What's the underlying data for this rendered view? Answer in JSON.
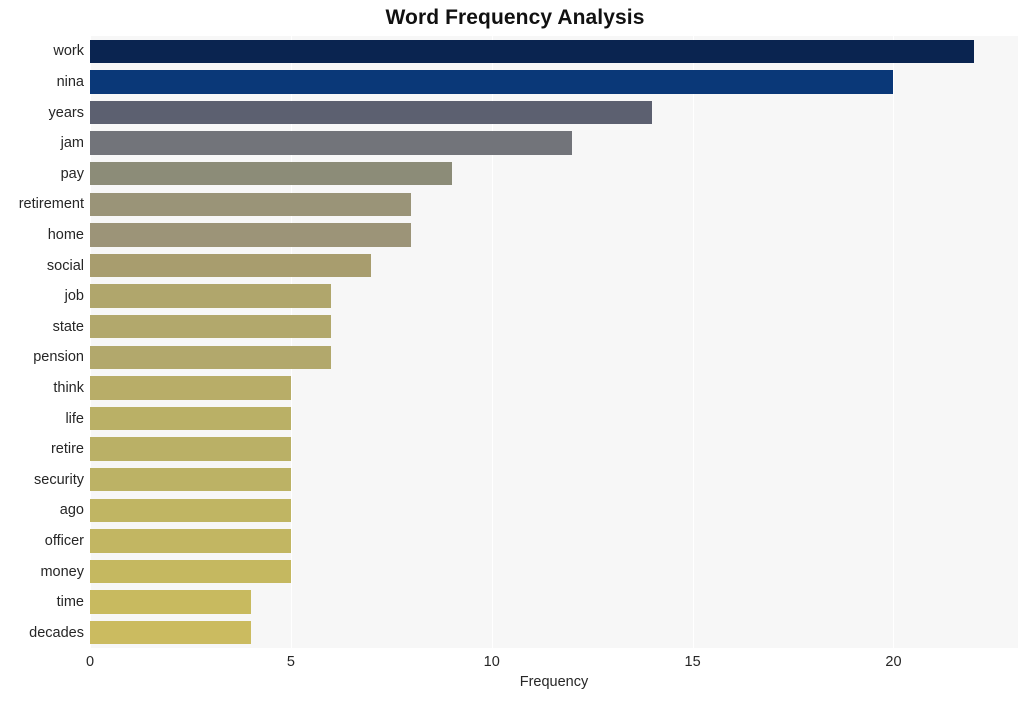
{
  "chart_data": {
    "type": "bar",
    "orientation": "horizontal",
    "title": "Word Frequency Analysis",
    "xlabel": "Frequency",
    "ylabel": "",
    "categories": [
      "work",
      "nina",
      "years",
      "jam",
      "pay",
      "retirement",
      "home",
      "social",
      "job",
      "state",
      "pension",
      "think",
      "life",
      "retire",
      "security",
      "ago",
      "officer",
      "money",
      "time",
      "decades"
    ],
    "values": [
      22,
      20,
      14,
      12,
      9,
      8,
      8,
      7,
      6,
      6,
      6,
      5,
      5,
      5,
      5,
      5,
      5,
      5,
      4,
      4
    ],
    "bar_colors": [
      "#0a2450",
      "#0a3878",
      "#5c6070",
      "#72747a",
      "#8c8c78",
      "#9a9478",
      "#9c9478",
      "#a89d6e",
      "#b0a66c",
      "#b2a86c",
      "#b2a86c",
      "#b8ad68",
      "#bab066",
      "#bab066",
      "#bcb265",
      "#c0b563",
      "#c2b662",
      "#c5b860",
      "#c8ba5f",
      "#cbbb60"
    ],
    "xlim": [
      0,
      23.1
    ],
    "xticks": [
      0,
      5,
      10,
      15,
      20
    ],
    "xticklabels": [
      "0",
      "5",
      "10",
      "15",
      "20"
    ],
    "yticklabels": [
      "work",
      "nina",
      "years",
      "jam",
      "pay",
      "retirement",
      "home",
      "social",
      "job",
      "state",
      "pension",
      "think",
      "life",
      "retire",
      "security",
      "ago",
      "officer",
      "money",
      "time",
      "decades"
    ],
    "grid": true,
    "grid_axis": "x",
    "legend": false,
    "plot_background": "#f7f7f7",
    "figure_background": "#ffffff",
    "grid_color": "#ffffff",
    "title_color": "#111111",
    "tick_label_color": "#262626"
  }
}
